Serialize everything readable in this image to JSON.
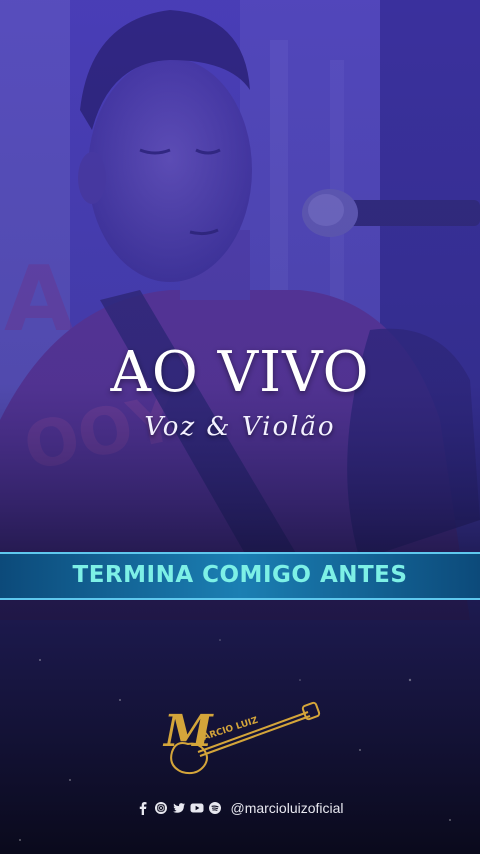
{
  "overlay": {
    "title": "AO VIVO",
    "subtitle": "Voz & Violão",
    "song_title": "TERMINA COMIGO ANTES"
  },
  "logo": {
    "text": "MARCIO LUIZ",
    "gold_color": "#d4a53a"
  },
  "social": {
    "icons": [
      "facebook-icon",
      "instagram-icon",
      "twitter-icon",
      "youtube-icon",
      "spotify-icon"
    ],
    "handle": "@marcioluizoficial"
  },
  "colors": {
    "tint": "#3a2fb0",
    "banner": "#1b7fb3",
    "banner_text": "#7df0e6",
    "background": "#0b0a1e"
  }
}
